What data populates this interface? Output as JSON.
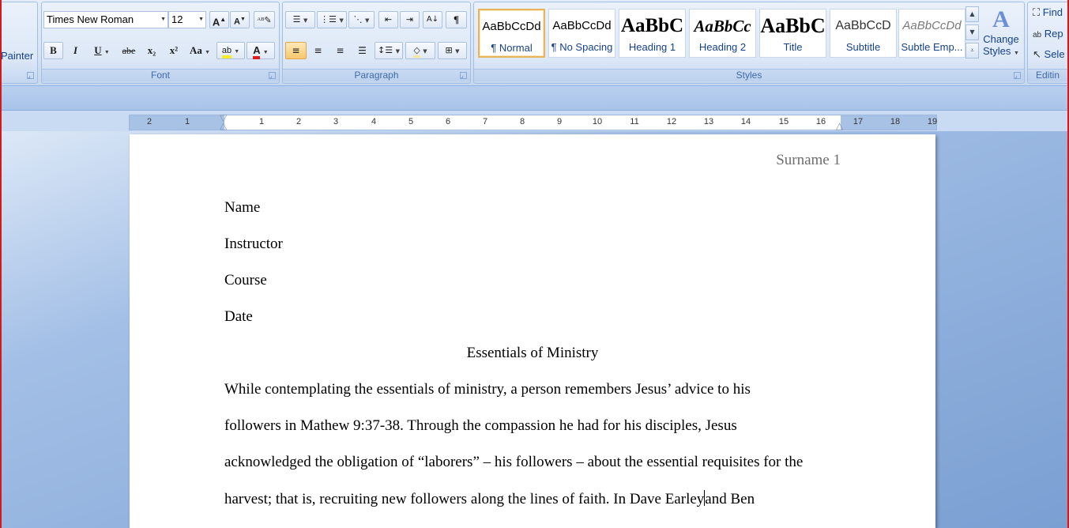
{
  "clipboard": {
    "painter_label": "Painter"
  },
  "font": {
    "name": "Times New Roman",
    "size": "12",
    "group_label": "Font",
    "grow": "A",
    "shrink": "A",
    "bold": "B",
    "italic": "I",
    "underline": "U",
    "strike": "abe",
    "subscript": "x₂",
    "superscript": "x²",
    "change_case": "Aa",
    "highlight": "ab",
    "color": "A"
  },
  "paragraph": {
    "group_label": "Paragraph",
    "pilcrow": "¶"
  },
  "styles": {
    "group_label": "Styles",
    "items": [
      {
        "preview": "AaBbCcDd",
        "name": "¶ Normal"
      },
      {
        "preview": "AaBbCcDd",
        "name": "¶ No Spacing"
      },
      {
        "preview": "AaBbC",
        "name": "Heading 1"
      },
      {
        "preview": "AaBbCc",
        "name": "Heading 2"
      },
      {
        "preview": "AaBbC",
        "name": "Title"
      },
      {
        "preview": "AaBbCcD",
        "name": "Subtitle"
      },
      {
        "preview": "AaBbCcDd",
        "name": "Subtle Emp..."
      }
    ],
    "change_styles_line1": "Change",
    "change_styles_line2": "Styles"
  },
  "editing": {
    "group_label": "Editin",
    "find": "Find",
    "replace": "Rep",
    "select": "Sele"
  },
  "ruler": {
    "numbers": [
      "2",
      "1",
      "1",
      "2",
      "3",
      "4",
      "5",
      "6",
      "7",
      "8",
      "9",
      "10",
      "11",
      "12",
      "13",
      "14",
      "15",
      "16",
      "17",
      "18",
      "19"
    ]
  },
  "document": {
    "header": "Surname 1",
    "lines": [
      "Name",
      "Instructor",
      "Course",
      "Date"
    ],
    "title": "Essentials of Ministry",
    "body": [
      "While contemplating the essentials of ministry, a person remembers Jesus’ advice to his",
      "followers in Mathew 9:37-38. Through the compassion he had for his disciples, Jesus",
      "acknowledged the obligation of “laborers” – his followers – about the essential requisites for the"
    ],
    "last_line_before_caret": "harvest; that is, recruiting new followers along the lines of faith. In Dave Earley",
    "last_line_after_caret": "and Ben"
  }
}
